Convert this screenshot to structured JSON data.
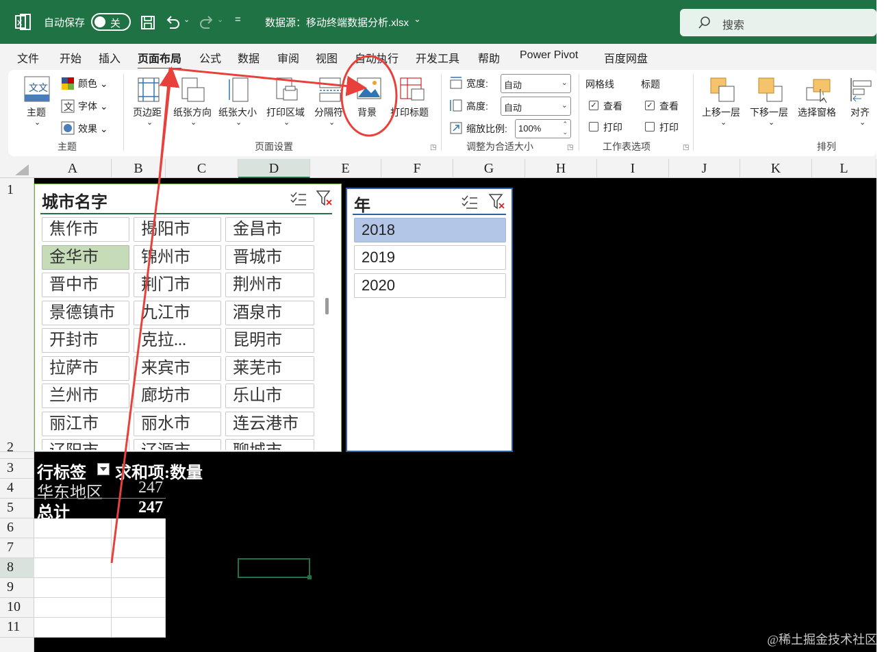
{
  "titlebar": {
    "autosave_label": "自动保存",
    "autosave_state": "关",
    "filename": "数据源：移动终端数据分析.xlsx",
    "search_placeholder": "搜索"
  },
  "menu": {
    "tabs": [
      "文件",
      "开始",
      "插入",
      "页面布局",
      "公式",
      "数据",
      "审阅",
      "视图",
      "自动执行",
      "开发工具",
      "帮助",
      "Power Pivot",
      "百度网盘"
    ],
    "active_tab": "页面布局"
  },
  "ribbon": {
    "themes": {
      "theme": "主题",
      "colors": "颜色",
      "fonts": "字体",
      "effects": "效果",
      "group": "主题"
    },
    "page_setup": {
      "margins": "页边距",
      "orientation": "纸张方向",
      "size": "纸张大小",
      "print_area": "打印区域",
      "breaks": "分隔符",
      "background": "背景",
      "print_titles": "打印标题",
      "group": "页面设置"
    },
    "scale": {
      "width_label": "宽度:",
      "width_value": "自动",
      "height_label": "高度:",
      "height_value": "自动",
      "scale_label": "缩放比例:",
      "scale_value": "100%",
      "group": "调整为合适大小"
    },
    "sheet_options": {
      "gridlines": "网格线",
      "headings": "标题",
      "view": "查看",
      "print": "打印",
      "group": "工作表选项"
    },
    "arrange": {
      "bring_forward": "上移一层",
      "send_backward": "下移一层",
      "selection_pane": "选择窗格",
      "align": "对齐",
      "group": "排列"
    }
  },
  "columns": [
    "A",
    "B",
    "C",
    "D",
    "E",
    "F",
    "G",
    "H",
    "I",
    "J",
    "K",
    "L"
  ],
  "selected_column": "D",
  "rows": [
    "1",
    "2",
    "3",
    "4",
    "5",
    "6",
    "7",
    "8",
    "9",
    "10",
    "11"
  ],
  "selected_row": "8",
  "city_slicer": {
    "title": "城市名字",
    "items": [
      "焦作市",
      "揭阳市",
      "金昌市",
      "金华市",
      "锦州市",
      "晋城市",
      "晋中市",
      "荆门市",
      "荆州市",
      "景德镇市",
      "九江市",
      "酒泉市",
      "开封市",
      "克拉...",
      "昆明市",
      "拉萨市",
      "来宾市",
      "莱芜市",
      "兰州市",
      "廊坊市",
      "乐山市",
      "丽江市",
      "丽水市",
      "连云港市",
      "辽阳市",
      "辽源市",
      "聊城市"
    ],
    "selected": "金华市"
  },
  "year_slicer": {
    "title": "年",
    "items": [
      "2018",
      "2019",
      "2020"
    ],
    "selected": "2018"
  },
  "pivot": {
    "row_label": "行标签",
    "value_label": "求和项:数量",
    "rows": [
      {
        "label": "华东地区",
        "value": "247"
      }
    ],
    "total_label": "总计",
    "total_value": "247"
  },
  "watermark": "@稀土掘金技术社区",
  "annotation": {
    "arrow_color": "#e8403a",
    "circle_color": "#e8403a"
  }
}
